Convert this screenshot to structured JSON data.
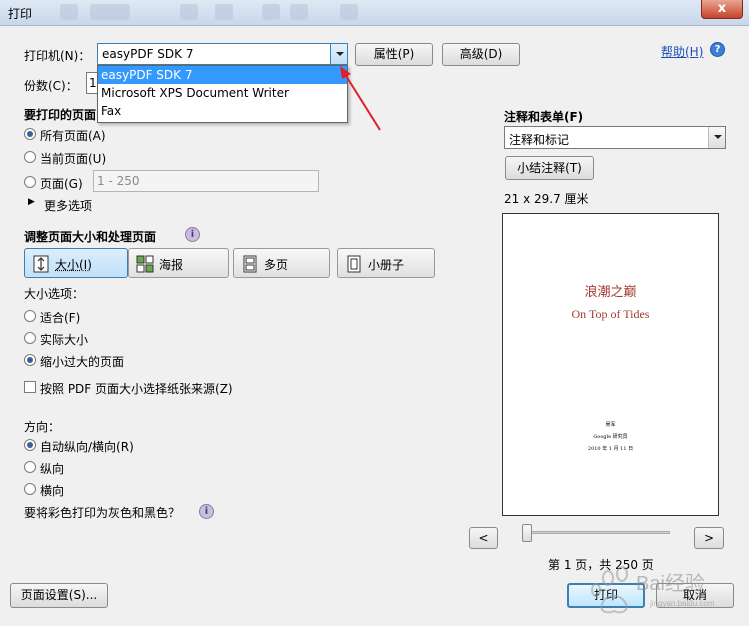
{
  "window": {
    "title": "打印",
    "close_label": "x"
  },
  "printer": {
    "label": "打印机(N)：",
    "selected": "easyPDF SDK 7",
    "options": [
      "easyPDF SDK 7",
      "Microsoft XPS Document Writer",
      "Fax"
    ],
    "properties_button": "属性(P)",
    "advanced_button": "高级(D)",
    "help_link": "帮助(H)",
    "help_icon": "?"
  },
  "copies": {
    "label": "份数(C)：",
    "value": "1"
  },
  "pages_to_print": {
    "heading": "要打印的页面",
    "all": "所有页面(A)",
    "current": "当前页面(U)",
    "pages": "页面(G)",
    "pages_value": "1 - 250",
    "more_options": "更多选项"
  },
  "sizing": {
    "heading": "调整页面大小和处理页面",
    "info_icon": "i",
    "modes": [
      {
        "label": "大小(I)",
        "icon": "size-icon"
      },
      {
        "label": "海报",
        "icon": "poster-icon"
      },
      {
        "label": "多页",
        "icon": "multiple-pages-icon"
      },
      {
        "label": "小册子",
        "icon": "booklet-icon"
      }
    ],
    "size_options_label": "大小选项：",
    "fit": "适合(F)",
    "actual_size": "实际大小",
    "shrink": "缩小过大的页面",
    "choose_paper_source": "按照 PDF 页面大小选择纸张来源(Z)"
  },
  "orientation": {
    "label": "方向：",
    "auto": "自动纵向/横向(R)",
    "portrait": "纵向",
    "landscape": "横向"
  },
  "grayscale": {
    "label": "要将彩色打印为灰色和黑色？",
    "info_icon": "i"
  },
  "comments": {
    "heading": "注释和表单(F)",
    "selected": "注释和标记",
    "summarize_button": "小结注释(T)",
    "page_size": "21 x 29.7 厘米"
  },
  "preview_page": {
    "title_cn": "浪潮之巅",
    "title_en": "On Top of Tides",
    "author": "吴军",
    "publisher": "Google 研究员",
    "date": "2010 年 1 月 11 日"
  },
  "navigation": {
    "prev": "<",
    "next": ">",
    "page_status": "第 1 页，共 250 页",
    "page_fraction": 0.0
  },
  "footer": {
    "page_setup": "页面设置(S)...",
    "print": "打印",
    "cancel": "取消"
  },
  "watermark": {
    "text": "Bai经验",
    "sub": "jingyan.baidu.com"
  },
  "colors": {
    "accent": "#3399ff",
    "arrow": "#e0202a",
    "preview_title": "#a23a2e"
  }
}
